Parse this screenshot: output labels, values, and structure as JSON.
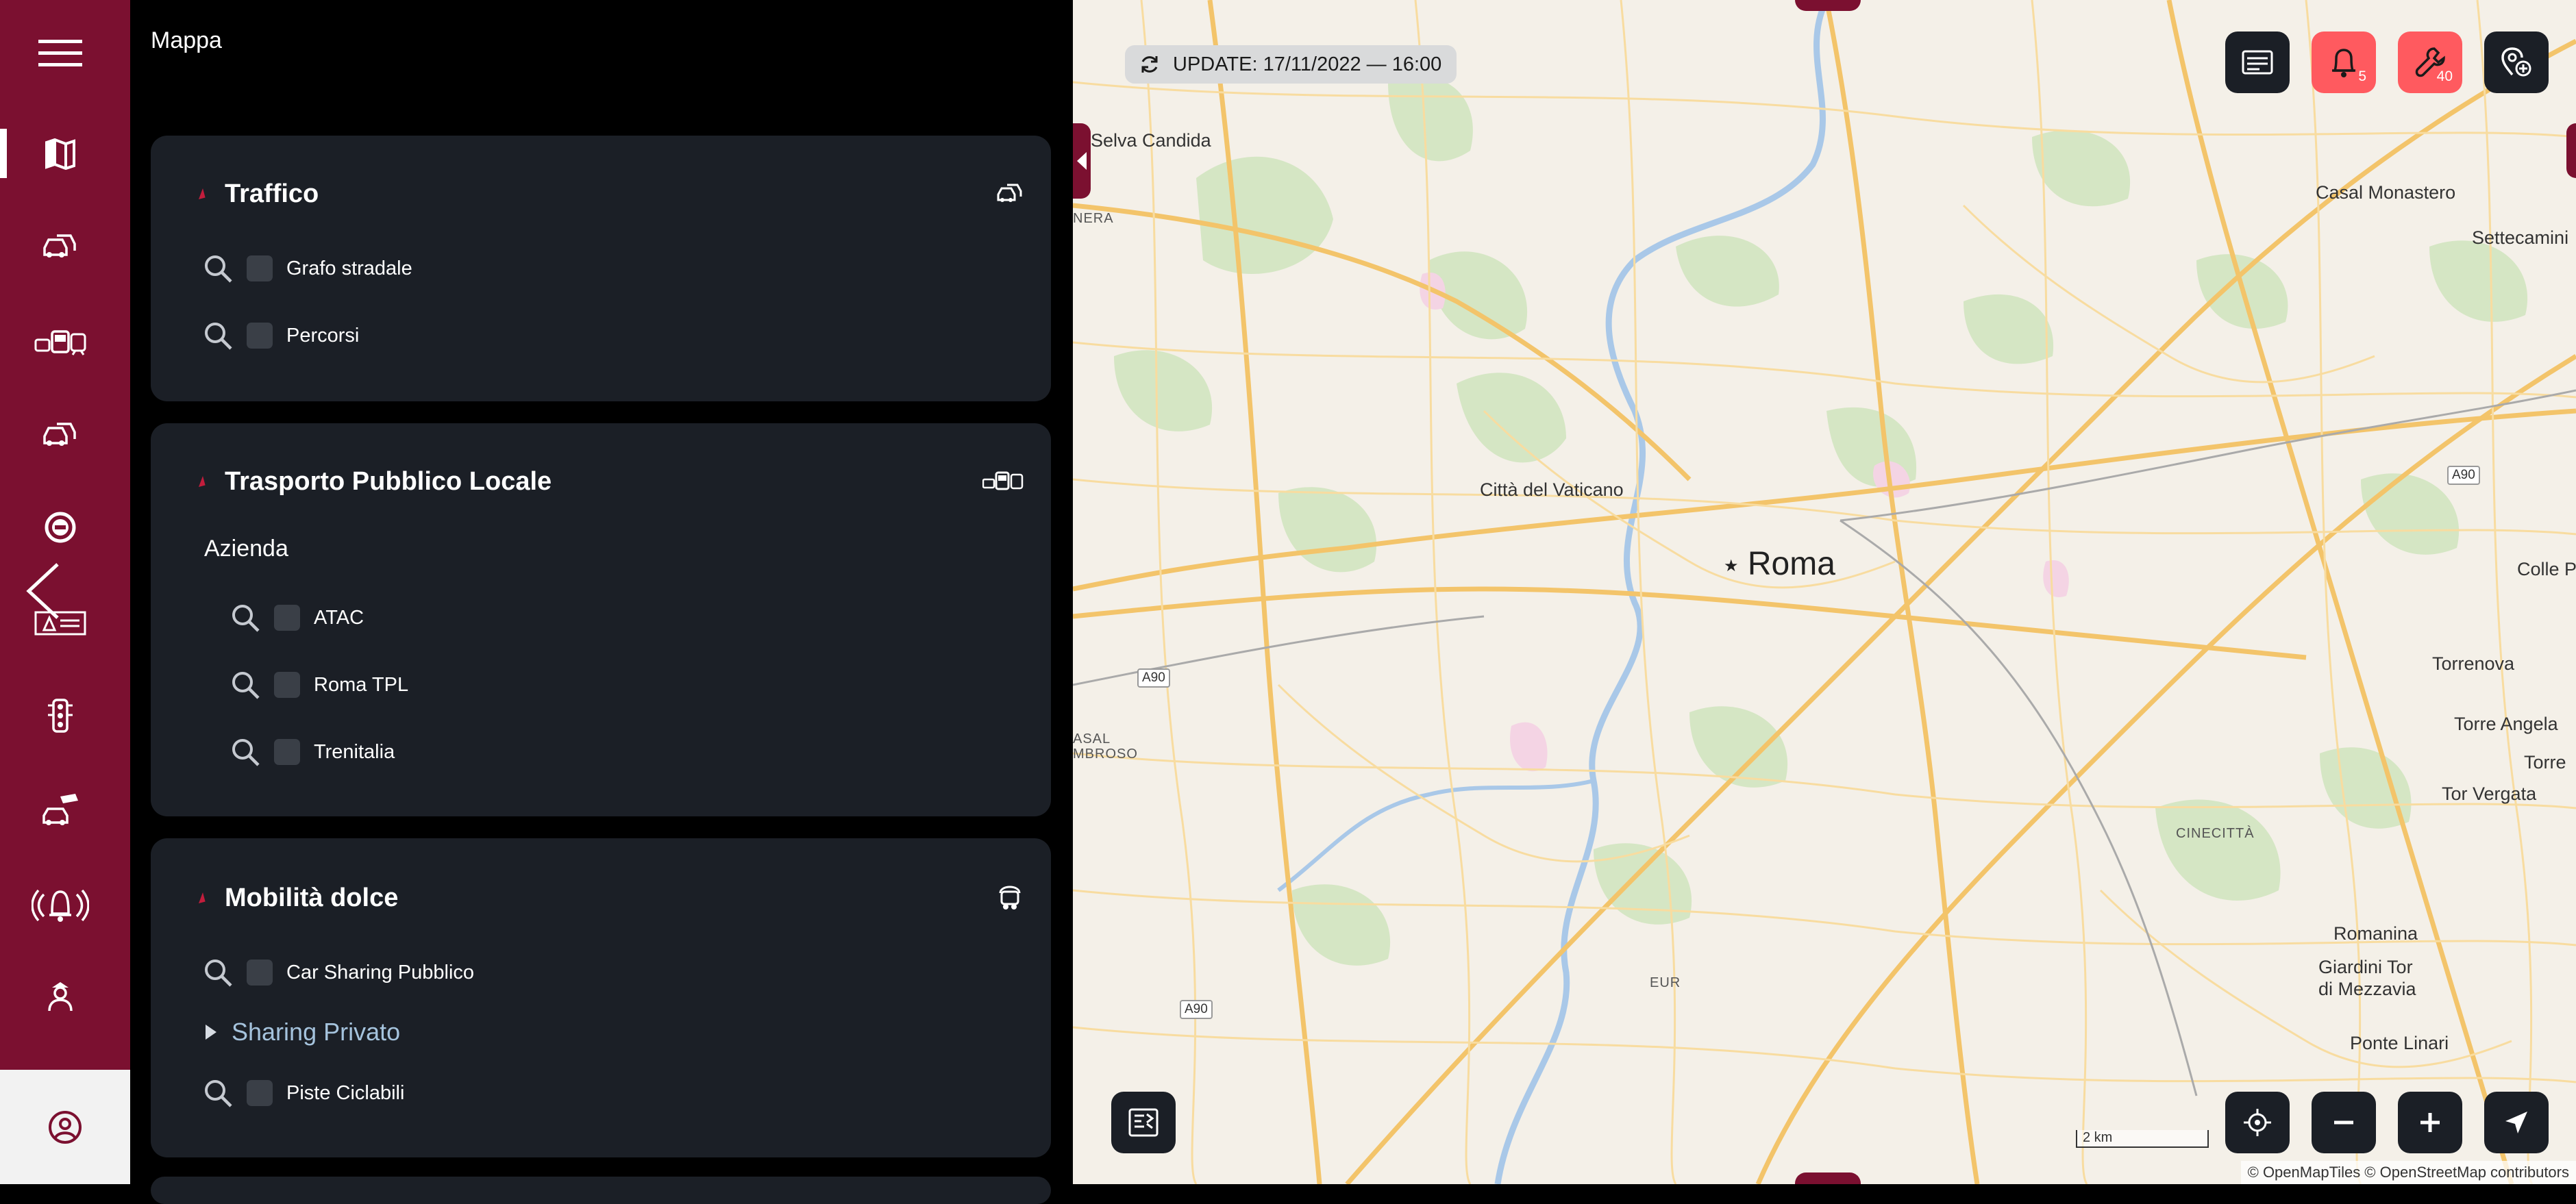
{
  "panel": {
    "title": "Mappa"
  },
  "traffico": {
    "title": "Traffico",
    "items": [
      "Grafo stradale",
      "Percorsi"
    ]
  },
  "tpl": {
    "title": "Trasporto Pubblico Locale",
    "subheading": "Azienda",
    "items": [
      "ATAC",
      "Roma TPL",
      "Trenitalia"
    ]
  },
  "mobilita": {
    "title": "Mobilità dolce",
    "items": [
      "Car Sharing Pubblico",
      "Piste Ciclabili"
    ],
    "expander": "Sharing Privato"
  },
  "map": {
    "update_text": "UPDATE: 17/11/2022 — 16:00",
    "alerts_count": "5",
    "maintenance_count": "40",
    "scale": "2 km",
    "attribution": "© OpenMapTiles © OpenStreetMap contributors",
    "labels": {
      "selva_candida": "Selva Candida",
      "casal_monastero": "Casal Monastero",
      "settecamini": "Settecamini",
      "citta_vaticano": "Città del Vaticano",
      "roma": "Roma",
      "colle_prenestino": "Colle Prene",
      "torrenova": "Torrenova",
      "torre_angela": "Torre Angela",
      "torre_maura": "Torre",
      "tor_vergata": "Tor Vergata",
      "cinecitta": "CINECITTÀ",
      "romanina": "Romanina",
      "giardini": "Giardini Tor\ndi Mezzavia",
      "ponte_linari": "Ponte Linari",
      "eur": "EUR",
      "nera": "NERA",
      "casal": "ASAL",
      "ambroso": "MBROSO"
    },
    "shields": {
      "a90_1": "A90",
      "a90_2": "A90",
      "a90_3": "A90"
    }
  }
}
